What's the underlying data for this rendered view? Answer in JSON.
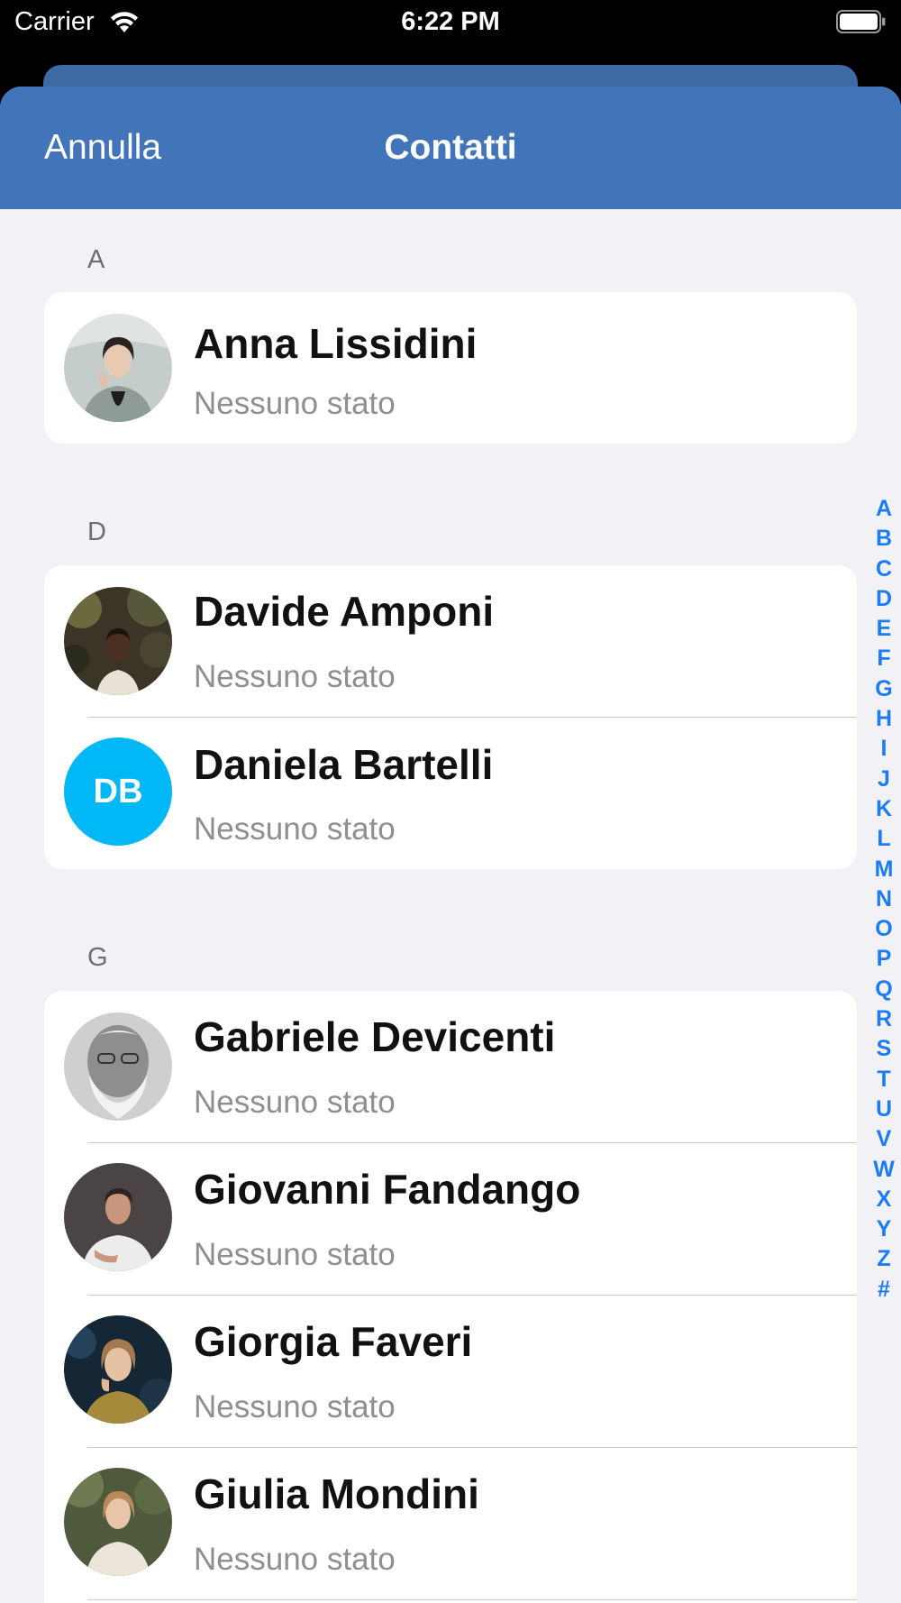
{
  "status_bar": {
    "carrier": "Carrier",
    "time": "6:22 PM"
  },
  "nav": {
    "cancel_label": "Annulla",
    "title": "Contatti",
    "color": "#4274ba"
  },
  "sections": [
    {
      "letter": "A",
      "contacts": [
        {
          "name": "Anna Lissidini",
          "status": "Nessuno stato",
          "avatar": "photo-woman-headshot"
        }
      ]
    },
    {
      "letter": "D",
      "contacts": [
        {
          "name": "Davide Amponi",
          "status": "Nessuno stato",
          "avatar": "photo-man-forest"
        },
        {
          "name": "Daniela Bartelli",
          "status": "Nessuno stato",
          "avatar": "initials",
          "initials": "DB",
          "avatar_color": "#00b8f5"
        }
      ]
    },
    {
      "letter": "G",
      "contacts": [
        {
          "name": "Gabriele Devicenti",
          "status": "Nessuno stato",
          "avatar": "photo-elderly-man-bw"
        },
        {
          "name": "Giovanni Fandango",
          "status": "Nessuno stato",
          "avatar": "photo-man-white-shirt"
        },
        {
          "name": "Giorgia Faveri",
          "status": "Nessuno stato",
          "avatar": "photo-woman-dark"
        },
        {
          "name": "Giulia Mondini",
          "status": "Nessuno stato",
          "avatar": "photo-woman-blazer"
        }
      ]
    }
  ],
  "index": [
    "A",
    "B",
    "C",
    "D",
    "E",
    "F",
    "G",
    "H",
    "I",
    "J",
    "K",
    "L",
    "M",
    "N",
    "O",
    "P",
    "Q",
    "R",
    "S",
    "T",
    "U",
    "V",
    "W",
    "X",
    "Y",
    "Z",
    "#"
  ],
  "accent": "#1b7cf5"
}
